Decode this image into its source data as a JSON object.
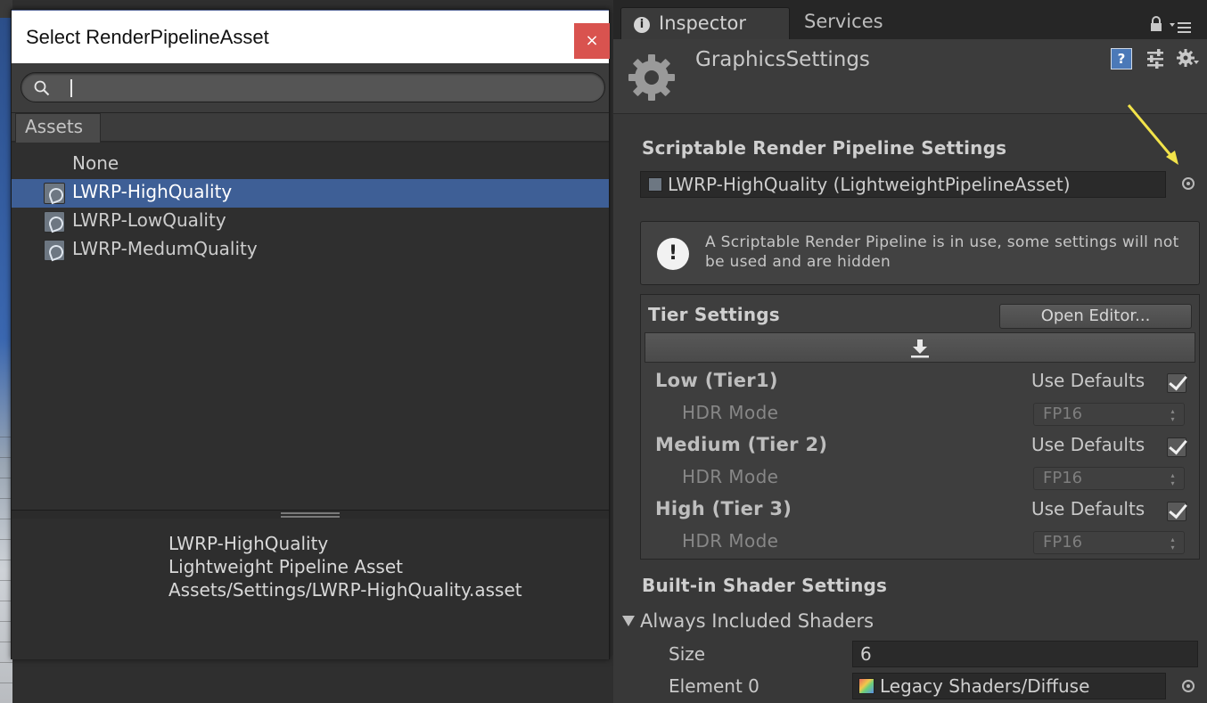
{
  "picker": {
    "title": "Select RenderPipelineAsset",
    "close_glyph": "×",
    "search_value": "",
    "assets_tab": "Assets",
    "items": [
      {
        "label": "None",
        "selected": false,
        "has_icon": false
      },
      {
        "label": "LWRP-HighQuality",
        "selected": true,
        "has_icon": true
      },
      {
        "label": "LWRP-LowQuality",
        "selected": false,
        "has_icon": true
      },
      {
        "label": "LWRP-MedumQuality",
        "selected": false,
        "has_icon": true
      }
    ],
    "preview": {
      "name": "LWRP-HighQuality",
      "type": "Lightweight Pipeline Asset",
      "path": "Assets/Settings/LWRP-HighQuality.asset"
    }
  },
  "inspector": {
    "tabs": {
      "inspector": "Inspector",
      "services": "Services"
    },
    "header_title": "GraphicsSettings",
    "help_glyph": "?",
    "srp_section": "Scriptable Render Pipeline Settings",
    "srp_value": "LWRP-HighQuality (LightweightPipelineAsset)",
    "helpbox": {
      "icon_glyph": "!",
      "text": "A Scriptable Render Pipeline is in use, some settings will not be used and are hidden"
    },
    "tier": {
      "title": "Tier Settings",
      "open_editor": "Open Editor...",
      "tiers": [
        {
          "name": "Low (Tier1)",
          "use_defaults": "Use Defaults",
          "checked": true,
          "hdr_label": "HDR Mode",
          "hdr_value": "FP16"
        },
        {
          "name": "Medium (Tier 2)",
          "use_defaults": "Use Defaults",
          "checked": true,
          "hdr_label": "HDR Mode",
          "hdr_value": "FP16"
        },
        {
          "name": "High (Tier 3)",
          "use_defaults": "Use Defaults",
          "checked": true,
          "hdr_label": "HDR Mode",
          "hdr_value": "FP16"
        }
      ]
    },
    "shader": {
      "section": "Built-in Shader Settings",
      "foldout": "Always Included Shaders",
      "size_label": "Size",
      "size_value": "6",
      "element0_label": "Element 0",
      "element0_value": "Legacy Shaders/Diffuse"
    }
  },
  "colors": {
    "selection": "#3e5f96",
    "close_button": "#d9534f",
    "annotation_arrow": "#f2e34a"
  }
}
